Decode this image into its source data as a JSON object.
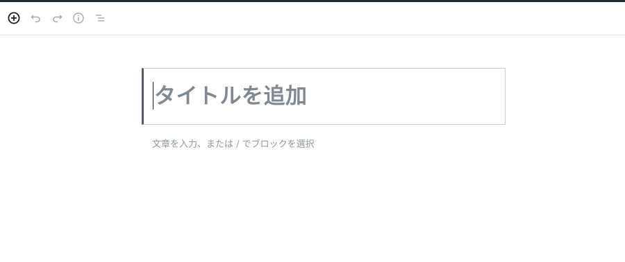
{
  "toolbar": {
    "buttons": [
      {
        "icon": "add-block-icon"
      },
      {
        "icon": "undo-icon"
      },
      {
        "icon": "redo-icon"
      },
      {
        "icon": "info-icon"
      },
      {
        "icon": "outline-icon"
      }
    ]
  },
  "editor": {
    "title_placeholder": "タイトルを追加",
    "body_placeholder": "文章を入力、または / でブロックを選択"
  },
  "colors": {
    "top_bar": "#23282d",
    "active_icon": "#1e1e1e",
    "disabled_icon": "#a2aab2",
    "title_border_accent": "#555d66",
    "placeholder_text": "#7e8993"
  }
}
